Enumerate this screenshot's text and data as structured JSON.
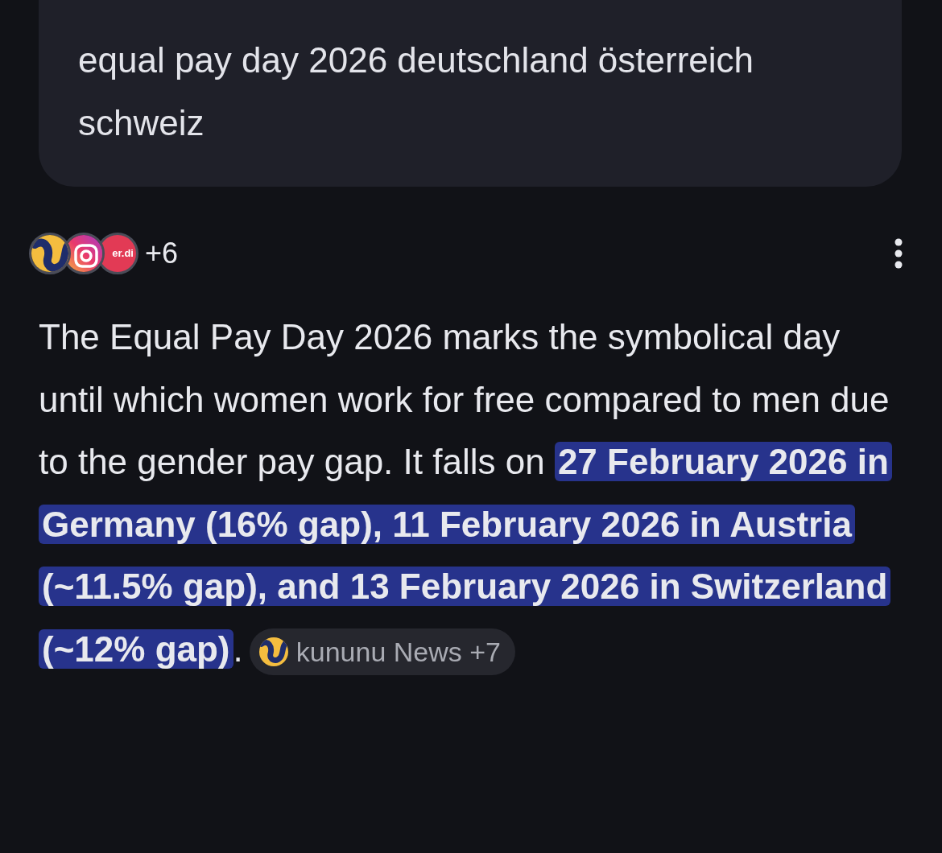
{
  "query": {
    "text": "equal pay day 2026 deutschland österreich schweiz"
  },
  "sources": {
    "logos": [
      {
        "kind": "kununu"
      },
      {
        "kind": "instagram"
      },
      {
        "kind": "verdi",
        "text": "er.di"
      }
    ],
    "more": "+6"
  },
  "answer": {
    "before": "The Equal Pay Day 2026 marks the symbolical day until which women work for free compared to men due to the gender pay gap. It falls on ",
    "highlight": "27 February 2026 in Germany (16% gap), 11 February 2026 in Austria (~11.5% gap), and 13 February 2026 in Switzerland (~12% gap)",
    "after": "."
  },
  "citation": {
    "label": "kununu News +7"
  }
}
